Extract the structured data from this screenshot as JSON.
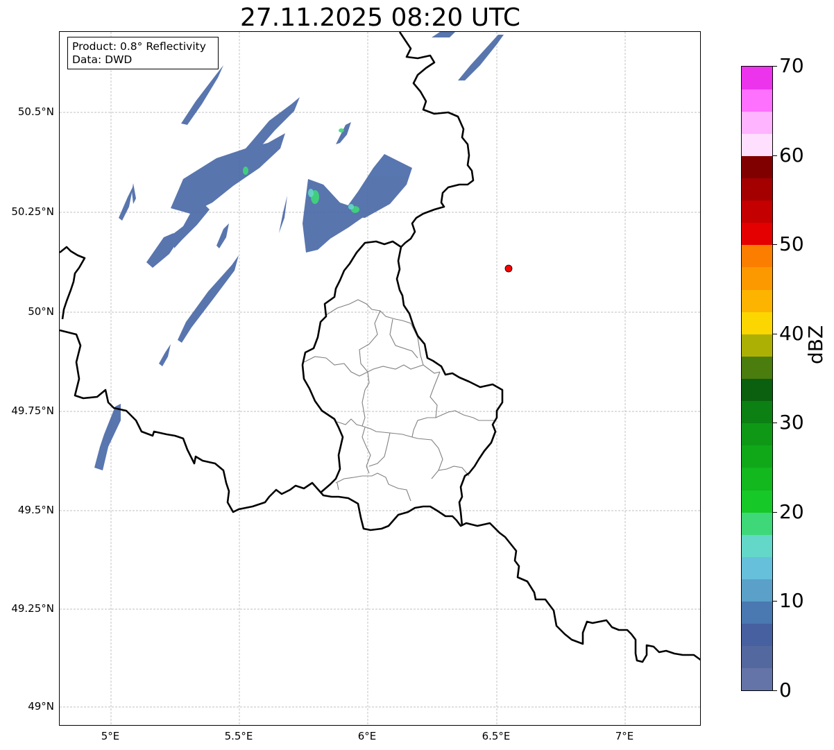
{
  "title": "27.11.2025 08:20 UTC",
  "info_box": {
    "product": "Product: 0.8° Reflectivity",
    "data": "Data: DWD"
  },
  "map": {
    "lat_labels": [
      "50.5°N",
      "50.25°N",
      "50°N",
      "49.75°N",
      "49.5°N",
      "49.25°N",
      "49°N"
    ],
    "lon_labels": [
      "5°E",
      "5.5°E",
      "6°E",
      "6.5°E",
      "7°E"
    ],
    "marker_color": "#ff0000",
    "border_color": "#000000",
    "district_color": "#808080"
  },
  "colorbar": {
    "label": "dBZ",
    "ticks": [
      "0",
      "10",
      "20",
      "30",
      "40",
      "50",
      "60",
      "70"
    ],
    "colors": [
      "#6474a8",
      "#5468a0",
      "#4660a0",
      "#4a78b0",
      "#5aa0c8",
      "#66c0dc",
      "#64d8c8",
      "#3ed878",
      "#16c828",
      "#12b81e",
      "#10a818",
      "#0e9816",
      "#0c8012",
      "#0a600e",
      "#4a7c0e",
      "#acb004",
      "#fcd600",
      "#fcb400",
      "#fc9800",
      "#fc7e00",
      "#e40000",
      "#c40000",
      "#a40000",
      "#800000",
      "#fee0fe",
      "#feb4fe",
      "#fe70fe",
      "#ec34ec"
    ]
  }
}
